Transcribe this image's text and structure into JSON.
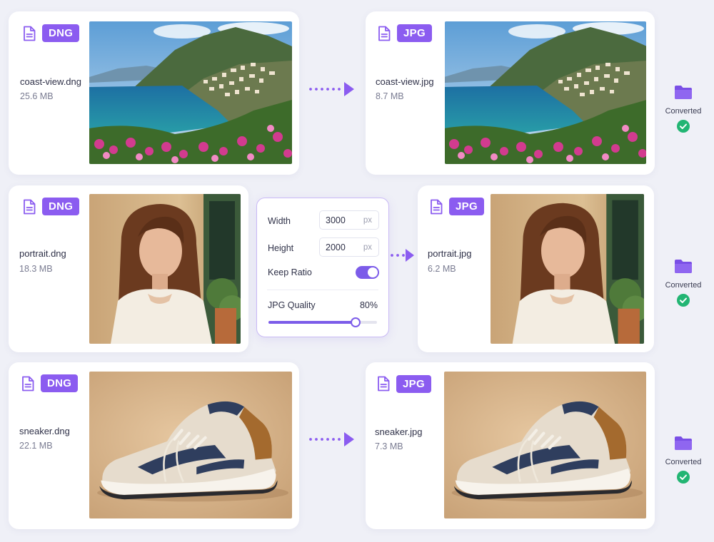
{
  "colors": {
    "accent": "#8b5cf0",
    "success": "#22b573",
    "background": "#eff0f7"
  },
  "icons": {
    "file": "file-icon",
    "arrow": "dotted-arrow-icon",
    "folder": "folder-icon",
    "check": "check-circle-icon"
  },
  "rows": [
    {
      "source": {
        "format": "DNG",
        "filename": "coast-view.dng",
        "size": "25.6 MB",
        "image": "coastal-cliff-village-photo"
      },
      "output": {
        "format": "JPG",
        "filename": "coast-view.jpg",
        "size": "8.7 MB",
        "image": "coastal-cliff-village-photo"
      },
      "status": "Converted"
    },
    {
      "source": {
        "format": "DNG",
        "filename": "portrait.dng",
        "size": "18.3 MB",
        "image": "woman-portrait-photo"
      },
      "output": {
        "format": "JPG",
        "filename": "portrait.jpg",
        "size": "6.2 MB",
        "image": "woman-portrait-photo"
      },
      "status": "Converted"
    },
    {
      "source": {
        "format": "DNG",
        "filename": "sneaker.dng",
        "size": "22.1 MB",
        "image": "sneaker-product-photo"
      },
      "output": {
        "format": "JPG",
        "filename": "sneaker.jpg",
        "size": "7.3 MB",
        "image": "sneaker-product-photo"
      },
      "status": "Converted"
    }
  ],
  "settings": {
    "width_label": "Width",
    "width_value": "3000",
    "height_label": "Height",
    "height_value": "2000",
    "unit": "px",
    "keep_ratio_label": "Keep Ratio",
    "keep_ratio_on": true,
    "quality_label": "JPG Quality",
    "quality_value": "80%",
    "quality_level": 0.8
  }
}
